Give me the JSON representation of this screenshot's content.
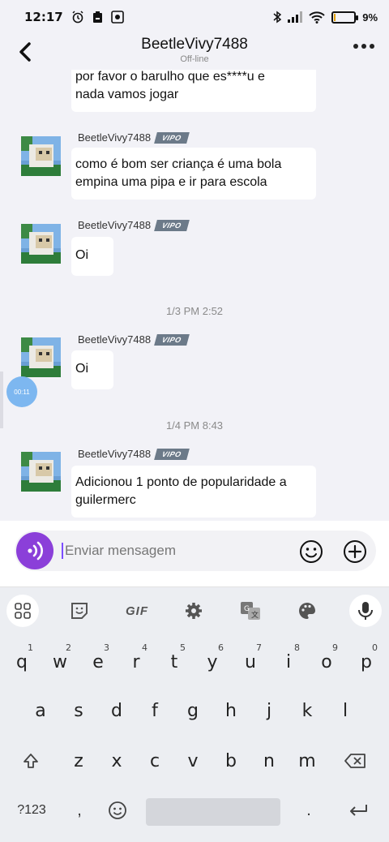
{
  "status_bar": {
    "time": "12:17",
    "battery_pct": "9",
    "battery_level": 0.09
  },
  "header": {
    "title": "BeetleVivy7488",
    "subtitle": "Off-line"
  },
  "messages": [
    {
      "text_line1": "por favor o barulho que es****u e",
      "text_line2": "nada vamos jogar"
    },
    {
      "sender": "BeetleVivy7488",
      "badge": "VIPO",
      "text_line1": "como é bom ser criança é uma bola",
      "text_line2": "empina uma pipa e ir para escola"
    },
    {
      "sender": "BeetleVivy7488",
      "badge": "VIPO",
      "text": "Oi"
    },
    {
      "timestamp": "1/3 PM 2:52"
    },
    {
      "sender": "BeetleVivy7488",
      "badge": "VIPO",
      "text": "Oi"
    },
    {
      "timestamp": "1/4 PM 8:43"
    },
    {
      "sender": "BeetleVivy7488",
      "badge": "VIPO",
      "text_line1": "Adicionou 1 ponto de popularidade a",
      "text_line2": "guilermerc"
    }
  ],
  "floating_bubble": "00:11",
  "composer": {
    "placeholder": "Enviar mensagem"
  },
  "keyboard": {
    "toolbar": [
      "apps-icon",
      "sticker-icon",
      "GIF",
      "settings-icon",
      "translate-icon",
      "palette-icon",
      "mic-icon"
    ],
    "gif_label": "GIF",
    "row1": [
      {
        "k": "q",
        "n": "1"
      },
      {
        "k": "w",
        "n": "2"
      },
      {
        "k": "e",
        "n": "3"
      },
      {
        "k": "r",
        "n": "4"
      },
      {
        "k": "t",
        "n": "5"
      },
      {
        "k": "y",
        "n": "6"
      },
      {
        "k": "u",
        "n": "7"
      },
      {
        "k": "i",
        "n": "8"
      },
      {
        "k": "o",
        "n": "9"
      },
      {
        "k": "p",
        "n": "0"
      }
    ],
    "row2": [
      "a",
      "s",
      "d",
      "f",
      "g",
      "h",
      "j",
      "k",
      "l"
    ],
    "row3": [
      "z",
      "x",
      "c",
      "v",
      "b",
      "n",
      "m"
    ],
    "symbols_label": "?123",
    "comma": ",",
    "period": "."
  }
}
